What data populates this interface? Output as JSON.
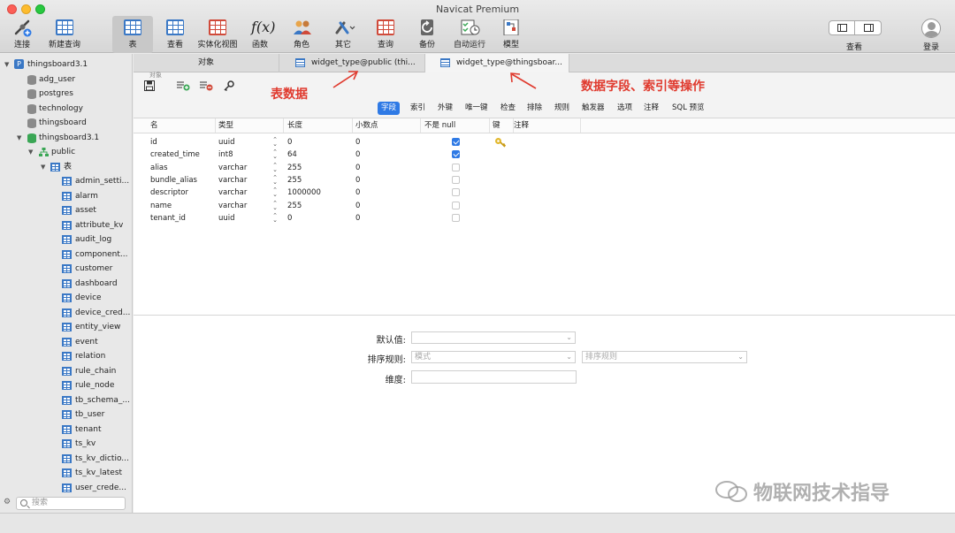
{
  "window": {
    "title": "Navicat Premium"
  },
  "toolbar": {
    "items": [
      {
        "label": "连接",
        "icon": "connection-icon"
      },
      {
        "label": "新建查询",
        "icon": "new-query-icon"
      },
      {
        "label": "表",
        "icon": "table-icon"
      },
      {
        "label": "查看",
        "icon": "view-icon"
      },
      {
        "label": "实体化视图",
        "icon": "materialized-view-icon"
      },
      {
        "label": "函数",
        "icon": "function-icon"
      },
      {
        "label": "角色",
        "icon": "role-icon"
      },
      {
        "label": "其它",
        "icon": "other-icon"
      },
      {
        "label": "查询",
        "icon": "query-icon"
      },
      {
        "label": "备份",
        "icon": "backup-icon"
      },
      {
        "label": "自动运行",
        "icon": "automation-icon"
      },
      {
        "label": "模型",
        "icon": "model-icon"
      }
    ],
    "function_glyph": "f(x)",
    "view_label": "查看",
    "login_label": "登录"
  },
  "sidebar": {
    "connection": "thingsboard3.1",
    "databases": [
      "adg_user",
      "postgres",
      "technology",
      "thingsboard"
    ],
    "open_database": "thingsboard3.1",
    "schema": "public",
    "tables_group": "表",
    "tables": [
      "admin_setti...",
      "alarm",
      "asset",
      "attribute_kv",
      "audit_log",
      "component...",
      "customer",
      "dashboard",
      "device",
      "device_cred...",
      "entity_view",
      "event",
      "relation",
      "rule_chain",
      "rule_node",
      "tb_schema_...",
      "tb_user",
      "tenant",
      "ts_kv",
      "ts_kv_dictio...",
      "ts_kv_latest",
      "user_crede..."
    ],
    "search_placeholder": "搜索"
  },
  "tabs": [
    {
      "label": "对象"
    },
    {
      "label": "widget_type@public (thi..."
    },
    {
      "label": "widget_type@thingsboar..."
    }
  ],
  "editor": {
    "small_label": "对象",
    "subtabs": [
      "字段",
      "索引",
      "外键",
      "唯一键",
      "检查",
      "排除",
      "规则",
      "触发器",
      "选项",
      "注释",
      "SQL 预览"
    ],
    "columns": [
      "名",
      "类型",
      "长度",
      "小数点",
      "不是 null",
      "键",
      "注释"
    ],
    "rows": [
      {
        "name": "id",
        "type": "uuid",
        "length": "0",
        "decimal": "0",
        "not_null": true,
        "key": true
      },
      {
        "name": "created_time",
        "type": "int8",
        "length": "64",
        "decimal": "0",
        "not_null": true,
        "key": false
      },
      {
        "name": "alias",
        "type": "varchar",
        "length": "255",
        "decimal": "0",
        "not_null": false,
        "key": false
      },
      {
        "name": "bundle_alias",
        "type": "varchar",
        "length": "255",
        "decimal": "0",
        "not_null": false,
        "key": false
      },
      {
        "name": "descriptor",
        "type": "varchar",
        "length": "1000000",
        "decimal": "0",
        "not_null": false,
        "key": false
      },
      {
        "name": "name",
        "type": "varchar",
        "length": "255",
        "decimal": "0",
        "not_null": false,
        "key": false
      },
      {
        "name": "tenant_id",
        "type": "uuid",
        "length": "0",
        "decimal": "0",
        "not_null": false,
        "key": false
      }
    ],
    "form": {
      "default_label": "默认值:",
      "collation_label": "排序规则:",
      "collation_mode_placeholder": "模式",
      "collation_placeholder": "排序规则",
      "dimension_label": "维度:"
    }
  },
  "annotations": {
    "table_data": "表数据",
    "field_ops": "数据字段、索引等操作",
    "color": "#e03a2e"
  },
  "watermark": "物联网技术指导",
  "colors": {
    "accent": "#2f7ae5",
    "annotation": "#e03a2e"
  }
}
